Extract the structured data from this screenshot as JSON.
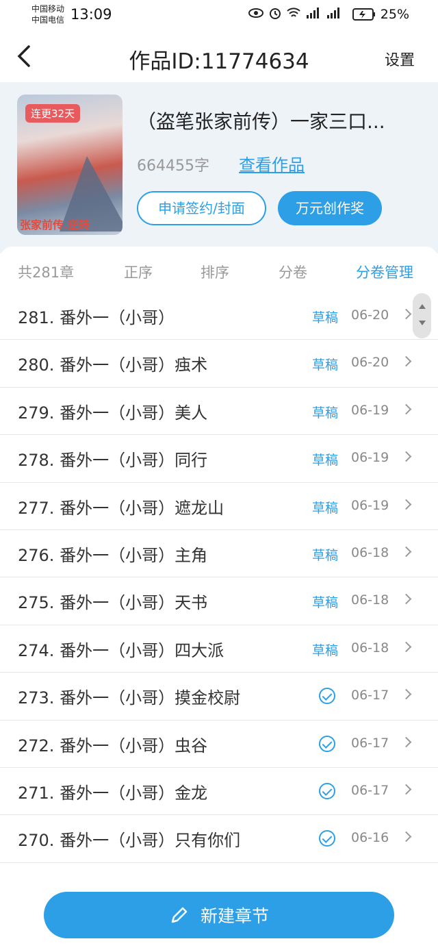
{
  "status_bar": {
    "carrier1": "中国移动",
    "carrier2": "中国电信",
    "time": "13:09",
    "battery": "25%"
  },
  "header": {
    "title": "作品ID:11774634",
    "settings_label": "设置",
    "back_icon": "chevron-left-icon"
  },
  "work": {
    "cover_badge": "连更32天",
    "cover_text": "张家前传.逆转",
    "title": "（盗笔张家前传）一家三口...",
    "word_count": "664455字",
    "view_link": "查看作品",
    "sign_button": "申请签约/封面",
    "award_button": "万元创作奖"
  },
  "tabs": {
    "count": "共281章",
    "order": "正序",
    "sort": "排序",
    "volume": "分卷",
    "volume_manage": "分卷管理"
  },
  "chapters": [
    {
      "title": "281. 番外一（小哥）",
      "status": "草稿",
      "date": "06-20"
    },
    {
      "title": "280. 番外一（小哥）痋术",
      "status": "草稿",
      "date": "06-20"
    },
    {
      "title": "279. 番外一（小哥）美人",
      "status": "草稿",
      "date": "06-19"
    },
    {
      "title": "278. 番外一（小哥）同行",
      "status": "草稿",
      "date": "06-19"
    },
    {
      "title": "277. 番外一（小哥）遮龙山",
      "status": "草稿",
      "date": "06-19"
    },
    {
      "title": "276. 番外一（小哥）主角",
      "status": "草稿",
      "date": "06-18"
    },
    {
      "title": "275. 番外一（小哥）天书",
      "status": "草稿",
      "date": "06-18"
    },
    {
      "title": "274. 番外一（小哥）四大派",
      "status": "草稿",
      "date": "06-18"
    },
    {
      "title": "273. 番外一（小哥）摸金校尉",
      "status": "",
      "date": "06-17"
    },
    {
      "title": "272. 番外一（小哥）虫谷",
      "status": "",
      "date": "06-17"
    },
    {
      "title": "271. 番外一（小哥）金龙",
      "status": "",
      "date": "06-17"
    },
    {
      "title": "270. 番外一（小哥）只有你们",
      "status": "",
      "date": "06-16"
    }
  ],
  "footer": {
    "new_chapter_label": "新建章节",
    "icon": "pencil-icon"
  },
  "colors": {
    "accent": "#2d9fe6",
    "badge_red": "#e75b5e",
    "card_bg": "#eef3f8"
  }
}
